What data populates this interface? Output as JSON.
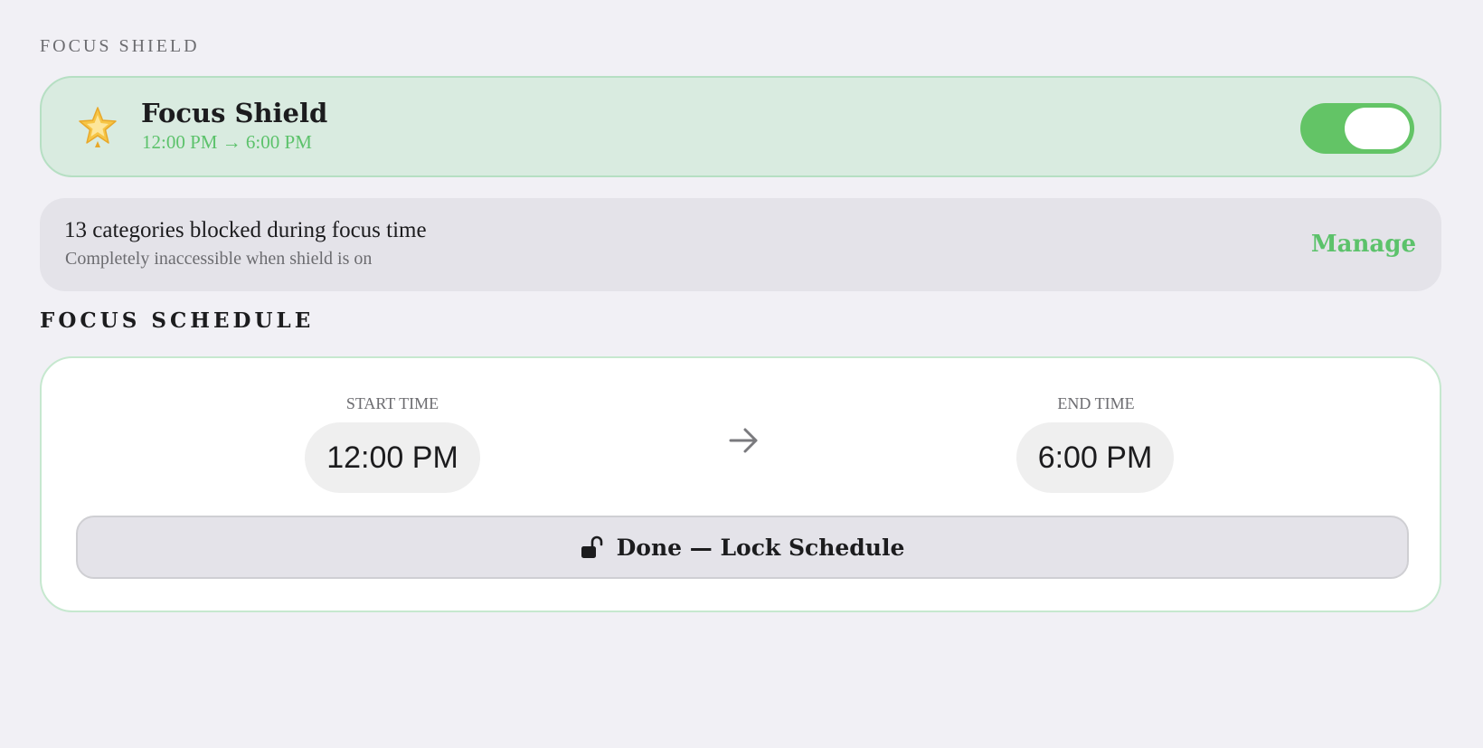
{
  "header": {
    "section_label": "FOCUS SHIELD"
  },
  "shield": {
    "icon": "glowing-star-icon",
    "title": "Focus Shield",
    "time_range": "12:00 PM → 6:00 PM",
    "enabled": true,
    "toggle_color": "#63c466"
  },
  "blocked": {
    "title": "13 categories blocked during focus time",
    "subtitle": "Completely inaccessible when shield is on",
    "manage_label": "Manage"
  },
  "schedule": {
    "section_label": "FOCUS SCHEDULE",
    "start_label": "START TIME",
    "start_value": "12:00 PM",
    "end_label": "END TIME",
    "end_value": "6:00 PM",
    "arrow_icon": "arrow-right-icon",
    "lock_button_label": "Done — Lock Schedule",
    "lock_icon": "unlocked-lock-icon"
  },
  "colors": {
    "accent": "#5cc26b",
    "background": "#f1f0f5"
  }
}
